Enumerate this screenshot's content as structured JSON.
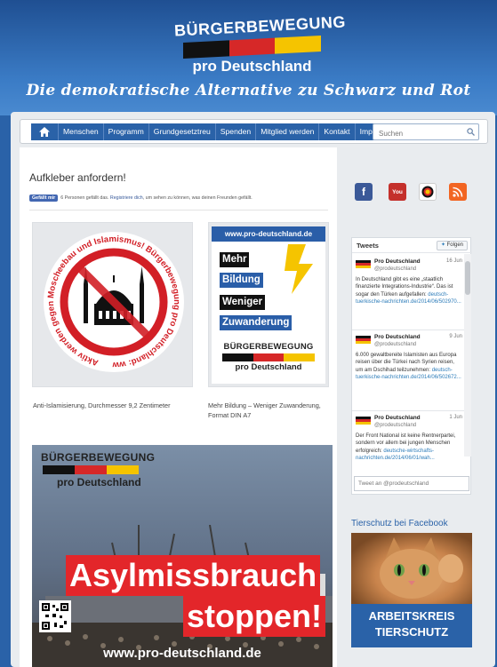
{
  "header": {
    "logo_top": "BÜRGERBEWEGUNG",
    "logo_bottom": "pro Deutschland",
    "tagline": "Die demokratische Alternative zu Schwarz und Rot",
    "flag_colors": [
      "#111111",
      "#d62828",
      "#f5c400"
    ]
  },
  "nav": {
    "home_icon": "home-icon",
    "items": [
      "Menschen",
      "Programm",
      "Grundgesetztreu",
      "Spenden",
      "Mitglied werden",
      "Kontakt",
      "Impressum"
    ],
    "search_placeholder": "Suchen"
  },
  "main": {
    "title": "Aufkleber anfordern!",
    "like": {
      "button": "Gefällt mir",
      "text_before": "6 Personen gefällt das.",
      "link": "Registriere dich",
      "text_after": ", um sehen zu können, was deinen Freunden gefällt."
    },
    "sticker1": {
      "ring_text": "Aktiv werden gegen Moscheebau und Islamismus!  Bürgerbewegung pro Deutschland: www.berlin-buergerbewegung.de",
      "caption": "Anti-Islamisierung, Durchmesser 9,2 Zentimeter"
    },
    "sticker2": {
      "url": "www.pro-deutschland.de",
      "words": [
        "Mehr",
        "Bildung",
        "Weniger",
        "Zuwanderung"
      ],
      "logo_top": "BÜRGERBEWEGUNG",
      "logo_bottom": "pro Deutschland",
      "caption": "Mehr Bildung – Weniger Zuwanderung, Format DIN A7"
    },
    "banner": {
      "logo_top": "BÜRGERBEWEGUNG",
      "logo_bottom": "pro Deutschland",
      "line1": "Asylmissbrauch",
      "line2": "stoppen!",
      "url": "www.pro-deutschland.de"
    }
  },
  "sidebar": {
    "social_icons": [
      "facebook-icon",
      "youtube-icon",
      "pro-deutschland-icon",
      "rss-icon"
    ],
    "tweets": {
      "title": "Tweets",
      "follow": "Folgen",
      "items": [
        {
          "name": "Pro Deutschland",
          "handle": "@prodeutschland",
          "date": "16 Jun",
          "text": "In Deutschland gibt es eine „staatlich finanzierte Integrations-Industrie“. Das ist sogar den Türken aufgefallen:",
          "link": "deutsch-tuerkische-nachrichten.de/2014/06/502970..."
        },
        {
          "name": "Pro Deutschland",
          "handle": "@prodeutschland",
          "date": "9 Jun",
          "text": "6.000 gewaltbereite Islamisten aus Europa reisen über die Türkei nach Syrien reisen, um am Dschihad teilzunehmen:",
          "link": "deutsch-tuerkische-nachrichten.de/2014/06/502672..."
        },
        {
          "name": "Pro Deutschland",
          "handle": "@prodeutschland",
          "date": "1 Jun",
          "text": "Der Front National ist keine Rentnerpartei, sondern vor allem bei jungen Menschen erfolgreich:",
          "link": "deutsche-wirtschafts-nachrichten.de/2014/06/01/wah..."
        }
      ],
      "compose_placeholder": "Tweet an @prodeutschland"
    },
    "facebook_title": "Tierschutz bei Facebook",
    "animal_box": {
      "line1": "ARBEITSKREIS",
      "line2": "TIERSCHUTZ"
    }
  }
}
